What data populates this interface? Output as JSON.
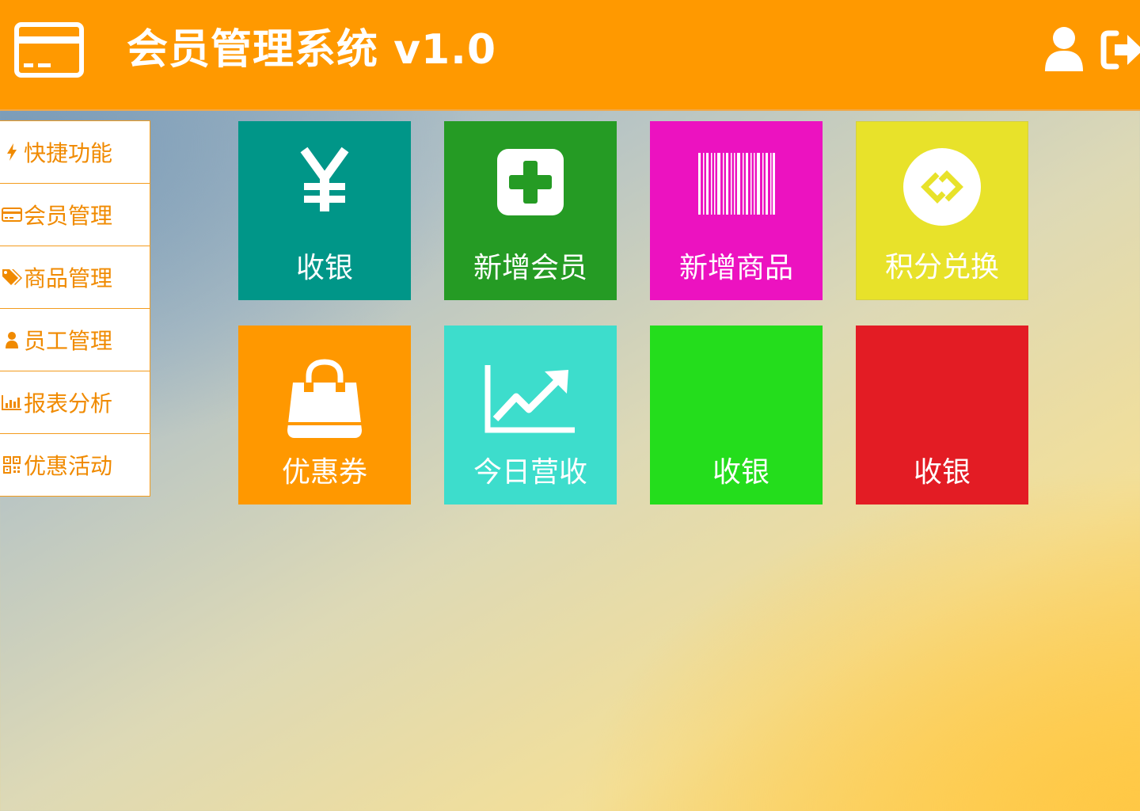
{
  "header": {
    "title": "会员管理系统 v1.0",
    "logo_icon": "membership-card-icon",
    "user_icon": "user-icon",
    "logout_icon": "sign-out-icon",
    "background_color": "#ff9900"
  },
  "sidebar": {
    "items": [
      {
        "label": "快捷功能",
        "icon": "lightning-icon"
      },
      {
        "label": "会员管理",
        "icon": "card-icon"
      },
      {
        "label": "商品管理",
        "icon": "tags-icon"
      },
      {
        "label": "员工管理",
        "icon": "person-icon"
      },
      {
        "label": "报表分析",
        "icon": "bar-chart-icon"
      },
      {
        "label": "优惠活动",
        "icon": "qrcode-icon"
      }
    ],
    "text_color": "#f08a00"
  },
  "tiles": [
    {
      "label": "收银",
      "icon": "yen-icon",
      "color": "#009688"
    },
    {
      "label": "新增会员",
      "icon": "plus-square-icon",
      "color": "#259b24"
    },
    {
      "label": "新增商品",
      "icon": "barcode-icon",
      "color": "#ec12c0"
    },
    {
      "label": "积分兑换",
      "icon": "exchange-circle-icon",
      "color": "#e8e22a"
    },
    {
      "label": "优惠券",
      "icon": "shopping-bag-icon",
      "color": "#ff9800"
    },
    {
      "label": "今日营收",
      "icon": "line-chart-icon",
      "color": "#3dddcc"
    },
    {
      "label": "收银",
      "icon": "",
      "color": "#24dd1c"
    },
    {
      "label": "收银",
      "icon": "",
      "color": "#e31c24"
    }
  ]
}
